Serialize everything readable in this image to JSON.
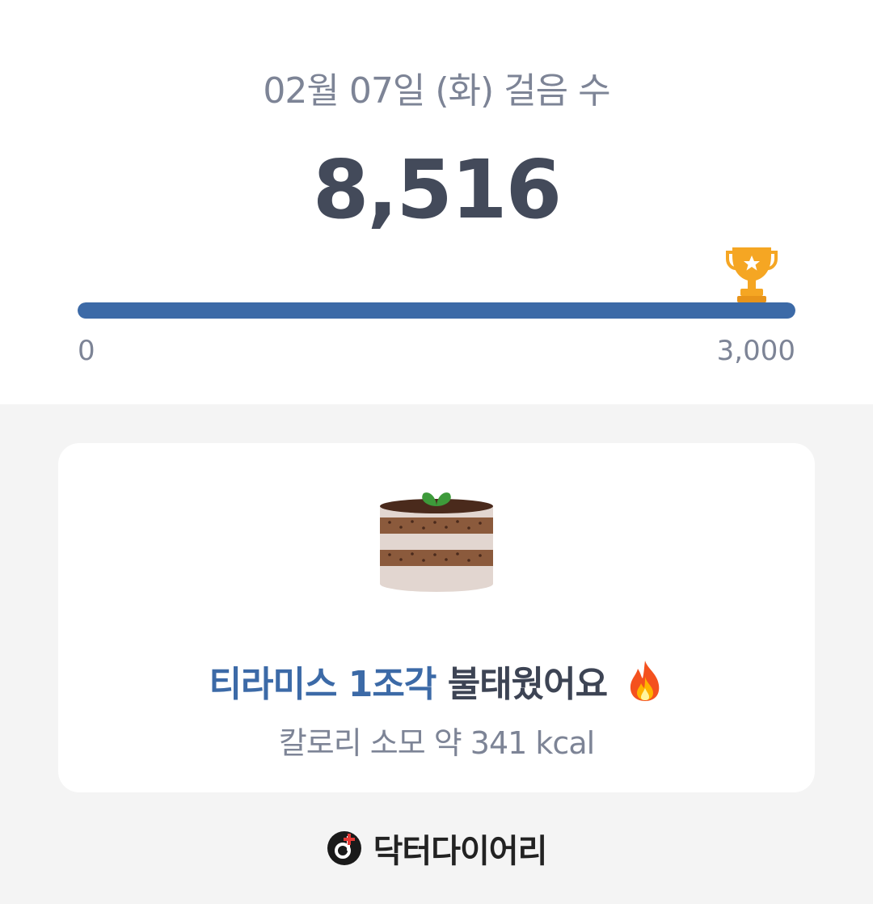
{
  "header": {
    "date": "02월 07일 (화)",
    "title": "걸음 수"
  },
  "steps": {
    "count": "8,516",
    "progress_fraction": 1.0
  },
  "goal": {
    "min_label": "0",
    "max_label": "3,000",
    "trophy_icon": "trophy-icon"
  },
  "achievement": {
    "food": "티라미스 1조각",
    "verb": "불태웠어요",
    "food_icon": "tiramisu-cake-icon",
    "fire_icon": "fire-icon",
    "calorie_text": "칼로리 소모 약 341 kcal"
  },
  "brand": {
    "name": "닥터다이어리",
    "logo_icon": "doctor-diary-logo-icon"
  },
  "colors": {
    "accent": "#3c6aa7",
    "text_dark": "#434a5a",
    "text_muted": "#7d8496",
    "background": "#f4f4f4",
    "trophy": "#f5a623"
  }
}
